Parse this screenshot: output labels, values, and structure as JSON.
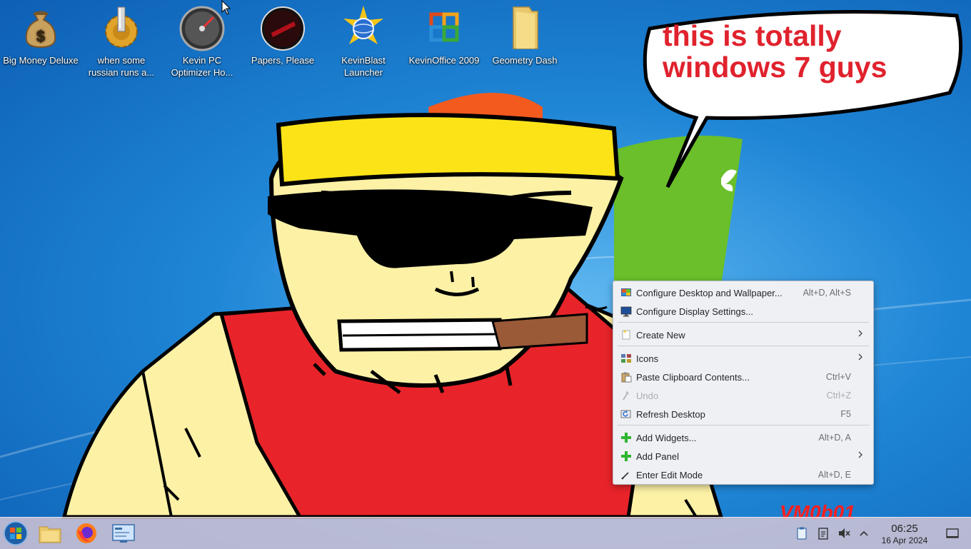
{
  "desktop": {
    "icons": [
      {
        "label": "Big Money Deluxe",
        "icon": "money-bag-icon"
      },
      {
        "label": "when some russian runs a...",
        "icon": "gear-icon"
      },
      {
        "label": "Kevin PC Optimizer Ho...",
        "icon": "speedometer-icon"
      },
      {
        "label": "Papers, Please",
        "icon": "papers-please-icon"
      },
      {
        "label": "KevinBlast Launcher",
        "icon": "globe-star-icon"
      },
      {
        "label": "KevinOffice 2009",
        "icon": "office-logo-icon"
      },
      {
        "label": "Geometry Dash",
        "icon": "folder-icon"
      }
    ],
    "speech_bubble": {
      "line1": "this is totally",
      "line2": "windows 7 guys"
    },
    "watermark": "VM0b01"
  },
  "context_menu": {
    "items": [
      {
        "label": "Configure Desktop and Wallpaper...",
        "shortcut": "Alt+D, Alt+S",
        "icon": "desktop-wallpaper-icon"
      },
      {
        "label": "Configure Display Settings...",
        "shortcut": "",
        "icon": "display-icon"
      },
      {
        "label": "Create New",
        "shortcut": "",
        "icon": "new-item-icon",
        "submenu": true
      },
      {
        "label": "Icons",
        "shortcut": "",
        "icon": "icons-grid-icon",
        "submenu": true
      },
      {
        "label": "Paste Clipboard Contents...",
        "shortcut": "Ctrl+V",
        "icon": "paste-icon"
      },
      {
        "label": "Undo",
        "shortcut": "Ctrl+Z",
        "icon": "undo-icon",
        "disabled": true
      },
      {
        "label": "Refresh Desktop",
        "shortcut": "F5",
        "icon": "refresh-icon"
      },
      {
        "label": "Add Widgets...",
        "shortcut": "Alt+D, A",
        "icon": "plus-icon"
      },
      {
        "label": "Add Panel",
        "shortcut": "",
        "icon": "plus-icon",
        "submenu": true
      },
      {
        "label": "Enter Edit Mode",
        "shortcut": "Alt+D, E",
        "icon": "edit-mode-icon"
      }
    ]
  },
  "taskbar": {
    "launchers": [
      "start-orb-icon",
      "file-manager-icon",
      "firefox-icon",
      "system-settings-icon"
    ],
    "tray": [
      "clipboard-icon",
      "notes-icon",
      "volume-muted-icon",
      "tray-expand-icon"
    ],
    "clock": {
      "time": "06:25",
      "date": "16 Apr 2024"
    }
  },
  "colors": {
    "bubble_text": "#e0222d",
    "watermark": "#ff1e1e",
    "menu_bg": "#eef0f3",
    "taskbar": "#e6cdd7"
  }
}
